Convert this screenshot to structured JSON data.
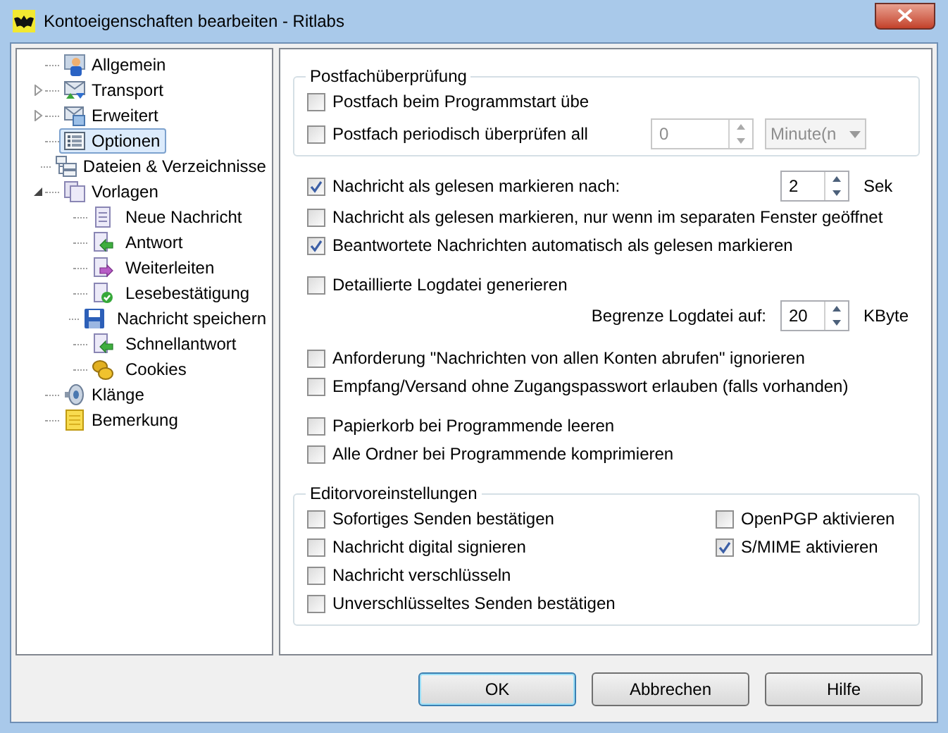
{
  "window": {
    "title": "Kontoeigenschaften bearbeiten - Ritlabs"
  },
  "tree": [
    {
      "label": "Allgemein",
      "selected": false
    },
    {
      "label": "Transport",
      "selected": false,
      "expanded": false
    },
    {
      "label": "Erweitert",
      "selected": false,
      "expanded": false
    },
    {
      "label": "Optionen",
      "selected": true
    },
    {
      "label": "Dateien & Verzeichnisse",
      "selected": false
    },
    {
      "label": "Vorlagen",
      "selected": false,
      "expanded": true,
      "children": [
        {
          "label": "Neue Nachricht",
          "selected": false
        },
        {
          "label": "Antwort",
          "selected": false
        },
        {
          "label": "Weiterleiten",
          "selected": false
        },
        {
          "label": "Lesebestätigung",
          "selected": false
        },
        {
          "label": "Nachricht speichern",
          "selected": false
        },
        {
          "label": "Schnellantwort",
          "selected": false
        },
        {
          "label": "Cookies",
          "selected": false
        }
      ]
    },
    {
      "label": "Klänge",
      "selected": false
    },
    {
      "label": "Bemerkung",
      "selected": false
    }
  ],
  "check_group": {
    "title": "Postfachüberprüfung",
    "items": [
      {
        "label": "Postfach beim Programmstart übe",
        "checked": false
      },
      {
        "label": "Postfach periodisch überprüfen all",
        "checked": false
      }
    ],
    "interval": {
      "value": "0",
      "disabled": true
    },
    "unit_dropdown": {
      "value": "Minute(n",
      "disabled": true
    }
  },
  "options": [
    [
      {
        "kind": "checkbox",
        "label": "Nachricht als gelesen markieren nach:",
        "checked": true,
        "spin": {
          "value": "2",
          "unit": "Sek"
        }
      },
      {
        "kind": "checkbox",
        "label": "Nachricht als gelesen markieren, nur wenn im separaten Fenster geöffnet",
        "checked": false
      },
      {
        "kind": "checkbox",
        "label": "Beantwortete Nachrichten automatisch als gelesen markieren",
        "checked": true
      }
    ],
    [
      {
        "kind": "checkbox",
        "label": "Detaillierte Logdatei generieren",
        "checked": false
      },
      {
        "kind": "limit",
        "label": "Begrenze Logdatei auf:",
        "spin": {
          "value": "20",
          "unit": "KByte"
        }
      }
    ],
    [
      {
        "kind": "checkbox",
        "label": "Anforderung \"Nachrichten von allen Konten abrufen\" ignorieren",
        "checked": false
      },
      {
        "kind": "checkbox",
        "label": "Empfang/Versand ohne Zugangspasswort erlauben (falls vorhanden)",
        "checked": false
      }
    ],
    [
      {
        "kind": "checkbox",
        "label": "Papierkorb bei Programmende leeren",
        "checked": false
      },
      {
        "kind": "checkbox",
        "label": "Alle Ordner bei Programmende komprimieren",
        "checked": false
      }
    ]
  ],
  "editor_group": {
    "title": "Editorvoreinstellungen",
    "left": [
      {
        "label": "Sofortiges Senden bestätigen",
        "checked": false
      },
      {
        "label": "Nachricht digital signieren",
        "checked": false
      },
      {
        "label": "Nachricht verschlüsseln",
        "checked": false
      },
      {
        "label": "Unverschlüsseltes Senden bestätigen",
        "checked": false
      }
    ],
    "right": [
      {
        "label": "OpenPGP aktivieren",
        "checked": false
      },
      {
        "label": "S/MIME aktivieren",
        "checked": true
      }
    ]
  },
  "buttons": [
    {
      "label": "OK",
      "default": true
    },
    {
      "label": "Abbrechen",
      "default": false
    },
    {
      "label": "Hilfe",
      "default": false
    }
  ]
}
